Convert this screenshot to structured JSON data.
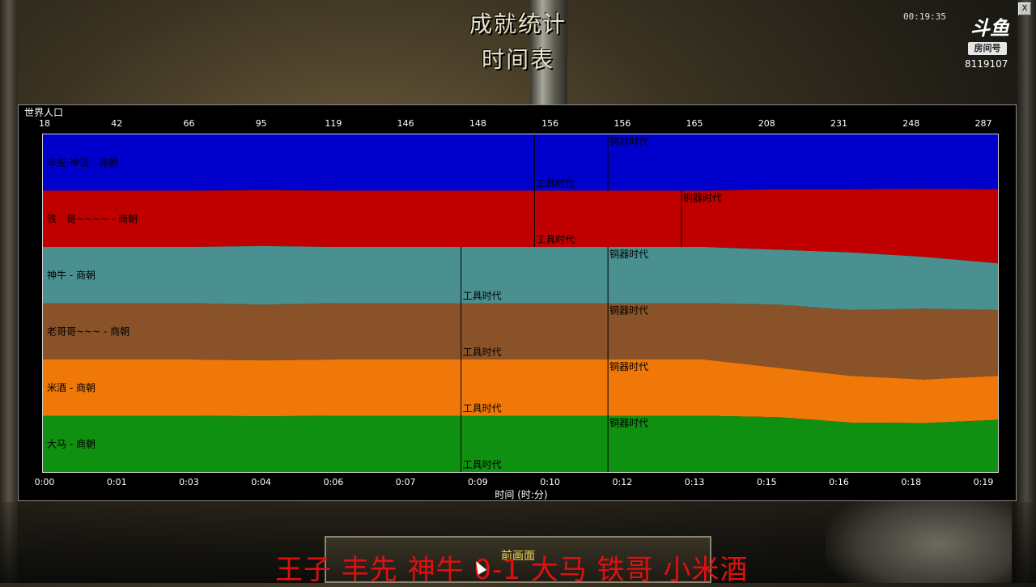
{
  "window": {
    "title_line1": "成就统计",
    "title_line2": "时间表",
    "clock": "00:19:35",
    "close_label": "X"
  },
  "stream_overlay": {
    "logo_text": "斗鱼",
    "room_label": "房间号",
    "room_number": "8119107",
    "caption": "王子 丰先 神牛 0-1 大马 铁哥 小米酒"
  },
  "footer": {
    "back_button_label": "前画面"
  },
  "chart_data": {
    "type": "area",
    "top_axis_label": "世界人口",
    "top_axis_ticks": [
      "18",
      "42",
      "66",
      "95",
      "119",
      "146",
      "148",
      "156",
      "156",
      "165",
      "208",
      "231",
      "248",
      "287"
    ],
    "x_ticks": [
      "0:00",
      "0:01",
      "0:03",
      "0:04",
      "0:06",
      "0:07",
      "0:09",
      "0:10",
      "0:12",
      "0:13",
      "0:15",
      "0:16",
      "0:18",
      "0:19"
    ],
    "xlabel": "时间 (时:分)",
    "series": [
      {
        "name": "丰先·神话 - 商朝",
        "color": "#0000cc",
        "values": [
          1.0,
          1.0,
          1.0,
          1.0,
          1.0,
          1.0,
          1.0,
          1.0,
          1.0,
          1.0,
          1.0,
          1.0,
          1.0,
          1.0
        ]
      },
      {
        "name": "铁　哥~~~~ - 商朝",
        "color": "#c00000",
        "values": [
          1.0,
          1.0,
          1.0,
          1.0,
          1.0,
          1.0,
          1.0,
          1.0,
          1.0,
          1.0,
          1.1,
          1.15,
          1.25,
          1.35
        ]
      },
      {
        "name": "神牛 - 商朝",
        "color": "#4a9090",
        "values": [
          1.0,
          1.0,
          1.0,
          1.05,
          1.0,
          1.0,
          1.0,
          1.0,
          1.0,
          1.0,
          1.0,
          1.05,
          0.95,
          0.85
        ]
      },
      {
        "name": "老哥哥~~~ - 商朝",
        "color": "#8a5228",
        "values": [
          1.0,
          1.0,
          1.0,
          1.0,
          1.0,
          1.0,
          1.0,
          1.0,
          1.0,
          1.0,
          1.15,
          1.2,
          1.3,
          1.2
        ]
      },
      {
        "name": "米酒 - 商朝",
        "color": "#f07808",
        "values": [
          1.0,
          1.0,
          1.0,
          1.0,
          1.0,
          1.0,
          1.0,
          1.0,
          1.0,
          1.0,
          0.9,
          0.85,
          0.8,
          0.8
        ]
      },
      {
        "name": "大马 - 商朝",
        "color": "#109010",
        "values": [
          1.0,
          1.0,
          1.0,
          1.0,
          1.0,
          1.0,
          1.0,
          1.0,
          1.0,
          1.0,
          1.0,
          0.9,
          0.9,
          0.95
        ]
      }
    ],
    "age_markers": [
      {
        "series": 0,
        "label": "工具时代",
        "time": "0:10"
      },
      {
        "series": 0,
        "label": "铜器时代",
        "time": "0:12"
      },
      {
        "series": 1,
        "label": "工具时代",
        "time": "0:10"
      },
      {
        "series": 1,
        "label": "铜器时代",
        "time": "0:13"
      },
      {
        "series": 2,
        "label": "工具时代",
        "time": "0:09"
      },
      {
        "series": 2,
        "label": "铜器时代",
        "time": "0:12"
      },
      {
        "series": 3,
        "label": "工具时代",
        "time": "0:09"
      },
      {
        "series": 3,
        "label": "铜器时代",
        "time": "0:12"
      },
      {
        "series": 4,
        "label": "工具时代",
        "time": "0:09"
      },
      {
        "series": 4,
        "label": "铜器时代",
        "time": "0:12"
      },
      {
        "series": 5,
        "label": "工具时代",
        "time": "0:09"
      },
      {
        "series": 5,
        "label": "铜器时代",
        "time": "0:12"
      }
    ]
  }
}
